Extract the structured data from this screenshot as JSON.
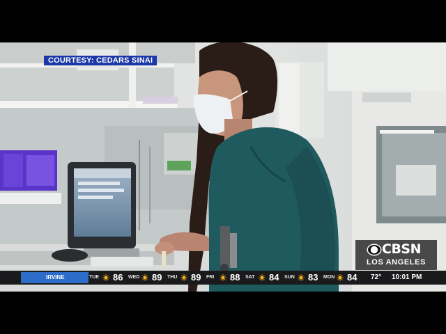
{
  "overlay": {
    "courtesy": "COURTESY: CEDARS SINAI"
  },
  "bug": {
    "brand": "CBSN",
    "city": "LOS ANGELES"
  },
  "ticker": {
    "location": "IRVINE",
    "days": [
      {
        "day": "TUE",
        "temp": "86"
      },
      {
        "day": "WED",
        "temp": "89"
      },
      {
        "day": "THU",
        "temp": "89"
      },
      {
        "day": "FRI",
        "temp": "88"
      },
      {
        "day": "SAT",
        "temp": "84"
      },
      {
        "day": "SUN",
        "temp": "83"
      },
      {
        "day": "MON",
        "temp": "84"
      }
    ],
    "current_temp": "72°",
    "time": "10:01 PM"
  },
  "colors": {
    "courtesy_bg": "#1b37a8",
    "ticker_location_bg": "#2d6cc8",
    "scrubs": "#1f5a5e",
    "sun_icon": "#f3b21b"
  }
}
